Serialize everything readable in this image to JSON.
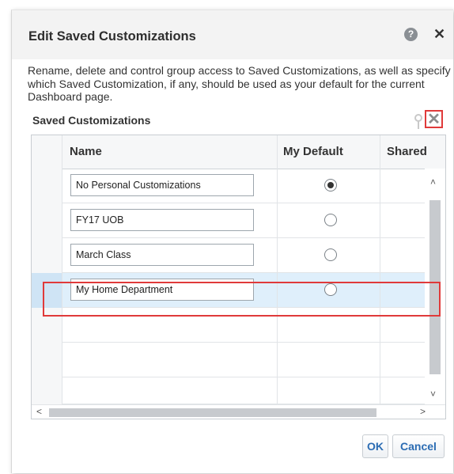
{
  "dialog": {
    "title": "Edit Saved Customizations",
    "help_icon": "question-circle-icon",
    "close_icon": "close-x-icon",
    "description": "Rename, delete and control group access to Saved Customizations, as well as specify which Saved Customization, if any, should be used as your default for the current Dashboard page."
  },
  "section": {
    "title": "Saved Customizations",
    "pin_icon": "pin-icon",
    "delete_icon": "delete-x-icon",
    "highlight_color": "#e03a3a"
  },
  "table": {
    "columns": [
      "Name",
      "My Default",
      "Shared"
    ],
    "rows": [
      {
        "name": "No Personal Customizations",
        "my_default": true,
        "selected": false
      },
      {
        "name": "FY17 UOB",
        "my_default": false,
        "selected": false
      },
      {
        "name": "March Class",
        "my_default": false,
        "selected": false
      },
      {
        "name": "My Home Department",
        "my_default": false,
        "selected": true
      }
    ]
  },
  "scrollbars": {
    "up": "˄",
    "down": "˅",
    "left": "<",
    "right": ">"
  },
  "buttons": {
    "ok": "OK",
    "cancel": "Cancel",
    "accent_color": "#2b6cb3"
  }
}
